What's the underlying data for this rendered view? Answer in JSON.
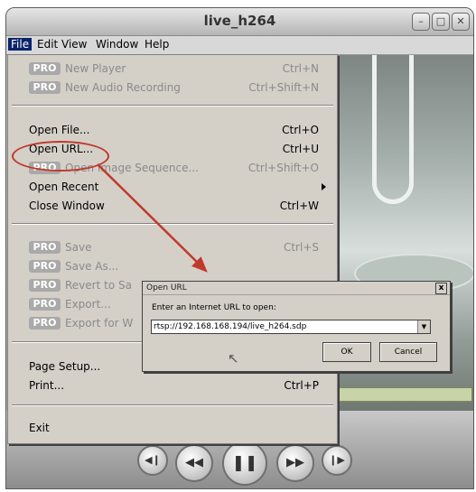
{
  "window": {
    "title": "live_h264"
  },
  "menubar": [
    "File",
    "Edit",
    "View",
    "Window",
    "Help"
  ],
  "pro_badge": "PRO",
  "file_menu": {
    "new_player": {
      "label": "New Player",
      "shortcut": "Ctrl+N"
    },
    "new_audio_recording": {
      "label": "New Audio Recording",
      "shortcut": "Ctrl+Shift+N"
    },
    "open_file": {
      "label": "Open File...",
      "shortcut": "Ctrl+O"
    },
    "open_url": {
      "label": "Open URL...",
      "shortcut": "Ctrl+U"
    },
    "open_image_sequence": {
      "label": "Open Image Sequence...",
      "shortcut": "Ctrl+Shift+O"
    },
    "open_recent": {
      "label": "Open Recent"
    },
    "close_window": {
      "label": "Close Window",
      "shortcut": "Ctrl+W"
    },
    "save": {
      "label": "Save",
      "shortcut": "Ctrl+S"
    },
    "save_as": {
      "label": "Save As..."
    },
    "revert_to_saved": {
      "label": "Revert to Sa"
    },
    "export": {
      "label": "Export..."
    },
    "export_for_web": {
      "label": "Export for W"
    },
    "page_setup": {
      "label": "Page Setup..."
    },
    "print": {
      "label": "Print...",
      "shortcut": "Ctrl+P"
    },
    "exit": {
      "label": "Exit"
    }
  },
  "dialog": {
    "title": "Open URL",
    "prompt": "Enter an Internet URL to open:",
    "url_value": "rtsp://192.168.168.194/live_h264.sdp",
    "ok_label": "OK",
    "cancel_label": "Cancel"
  },
  "colors": {
    "annotation": "#c0392b",
    "menu_highlight": "#0a246a"
  }
}
